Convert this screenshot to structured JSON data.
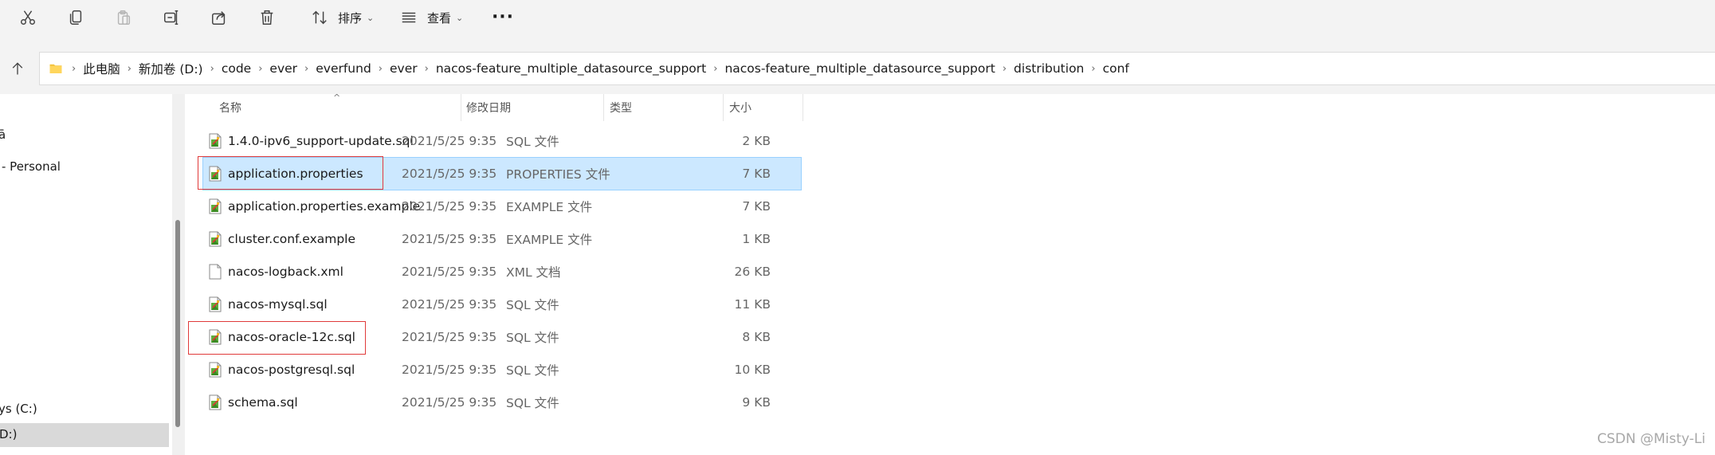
{
  "toolbar": {
    "cut_icon": "scissors-icon",
    "copy_icon": "copy-icon",
    "paste_icon": "paste-icon",
    "rename_icon": "rename-icon",
    "share_icon": "share-icon",
    "delete_icon": "trash-icon",
    "sort_label": "排序",
    "view_label": "查看",
    "more_label": "···"
  },
  "address": {
    "crumbs": [
      "此电脑",
      "新加卷 (D:)",
      "code",
      "ever",
      "everfund",
      "ever",
      "nacos-feature_multiple_datasource_support",
      "nacos-feature_multiple_datasource_support",
      "distribution",
      "conf"
    ],
    "separator": "›"
  },
  "nav": {
    "items": [
      "ā",
      "- Personal",
      "ys (C:)",
      "D:)"
    ]
  },
  "columns": {
    "name": "名称",
    "date": "修改日期",
    "type": "类型",
    "size": "大小"
  },
  "files": [
    {
      "name": "1.4.0-ipv6_support-update.sql",
      "date": "2021/5/25 9:35",
      "type": "SQL 文件",
      "size": "2 KB",
      "icon": "sql-file-icon"
    },
    {
      "name": "application.properties",
      "date": "2021/5/25 9:35",
      "type": "PROPERTIES 文件",
      "size": "7 KB",
      "icon": "properties-file-icon"
    },
    {
      "name": "application.properties.example",
      "date": "2021/5/25 9:35",
      "type": "EXAMPLE 文件",
      "size": "7 KB",
      "icon": "example-file-icon"
    },
    {
      "name": "cluster.conf.example",
      "date": "2021/5/25 9:35",
      "type": "EXAMPLE 文件",
      "size": "1 KB",
      "icon": "example-file-icon"
    },
    {
      "name": "nacos-logback.xml",
      "date": "2021/5/25 9:35",
      "type": "XML 文档",
      "size": "26 KB",
      "icon": "xml-file-icon"
    },
    {
      "name": "nacos-mysql.sql",
      "date": "2021/5/25 9:35",
      "type": "SQL 文件",
      "size": "11 KB",
      "icon": "sql-file-icon"
    },
    {
      "name": "nacos-oracle-12c.sql",
      "date": "2021/5/25 9:35",
      "type": "SQL 文件",
      "size": "8 KB",
      "icon": "sql-file-icon"
    },
    {
      "name": "nacos-postgresql.sql",
      "date": "2021/5/25 9:35",
      "type": "SQL 文件",
      "size": "10 KB",
      "icon": "sql-file-icon"
    },
    {
      "name": "schema.sql",
      "date": "2021/5/25 9:35",
      "type": "SQL 文件",
      "size": "9 KB",
      "icon": "sql-file-icon"
    }
  ],
  "selected_file": "application.properties",
  "watermark": "CSDN @Misty-Li",
  "colors": {
    "selection": "#cce8ff",
    "annotation_box": "#e03a3a",
    "toolbar_bg": "#f3f3f3"
  }
}
